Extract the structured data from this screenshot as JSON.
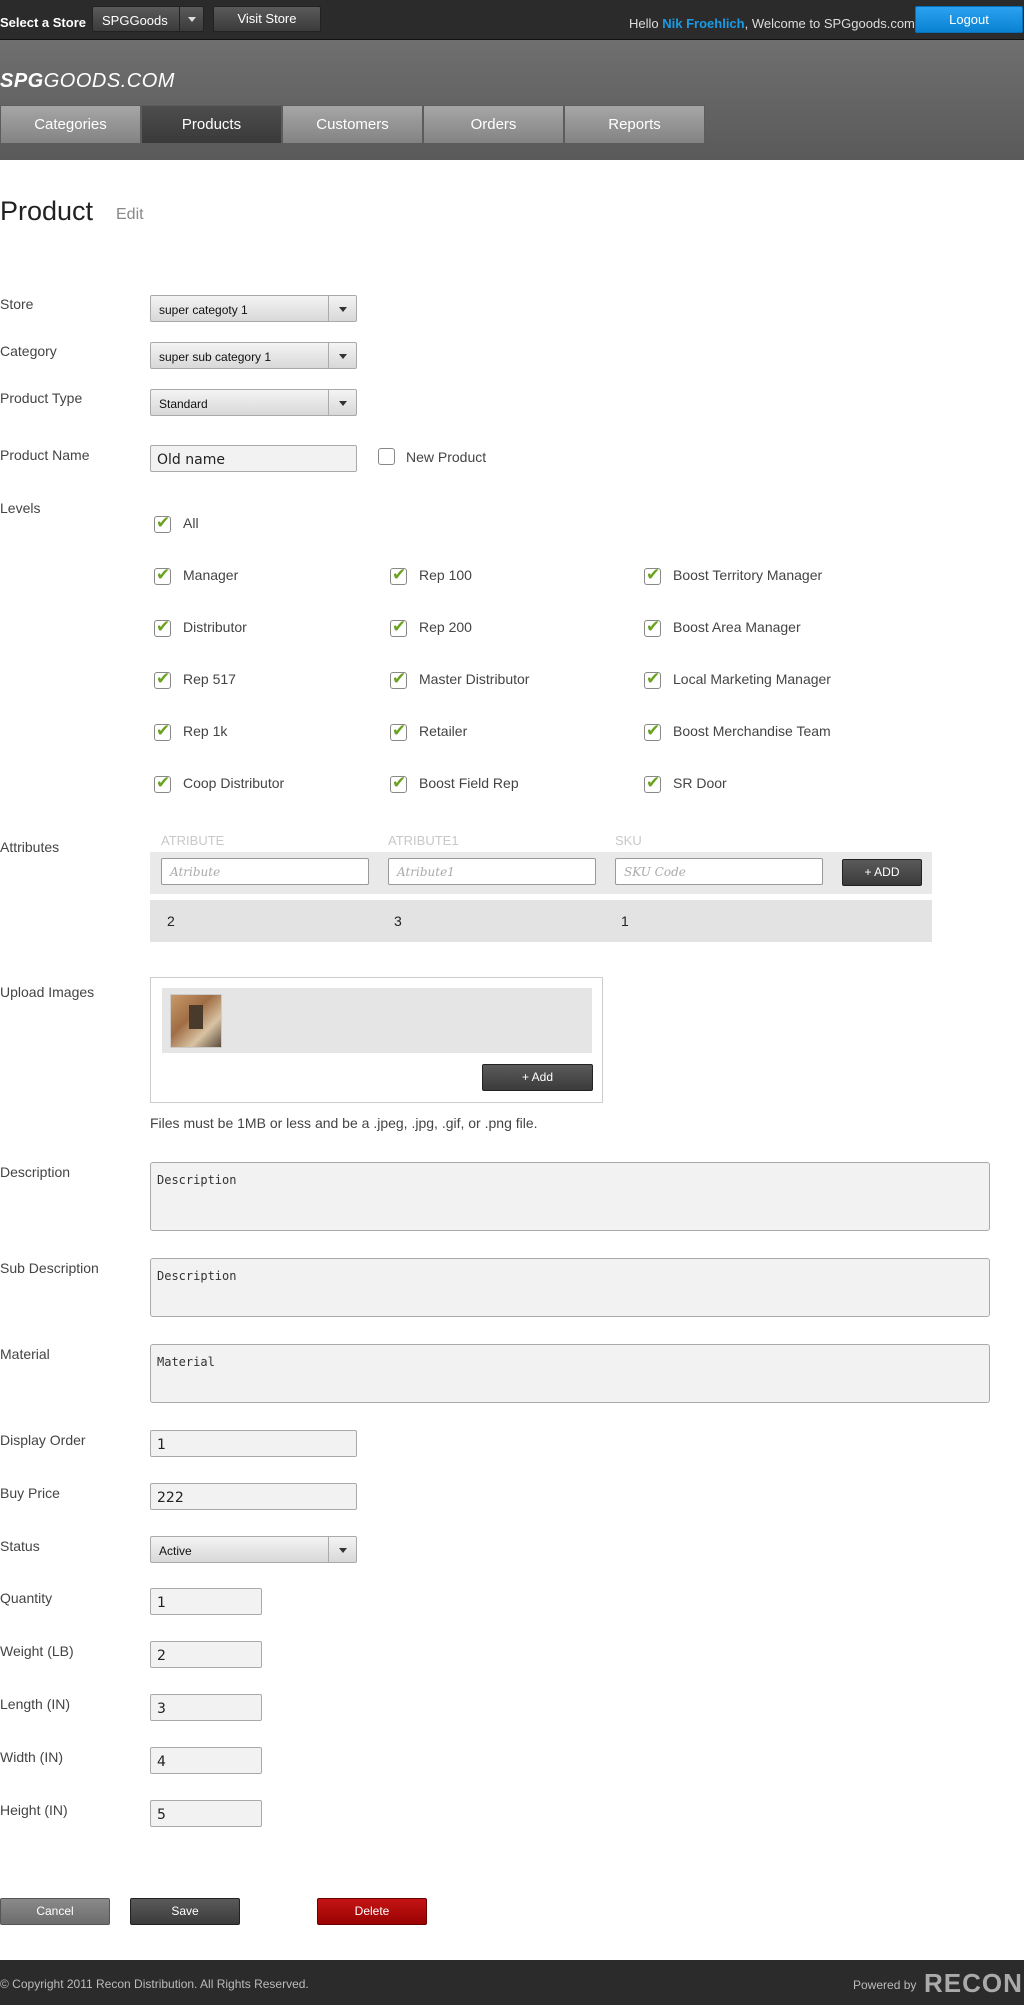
{
  "topbar": {
    "select_store_label": "Select a Store",
    "store_value": "SPGGoods",
    "visit_store_label": "Visit Store",
    "hello_prefix": "Hello",
    "user_name": "Nik Froehlich",
    "welcome_suffix": ", Welcome to SPGgoods.com",
    "logout_label": "Logout"
  },
  "header": {
    "logo_bold": "SPG",
    "logo_rest": "GOODS.COM",
    "nav": [
      "Categories",
      "Products",
      "Customers",
      "Orders",
      "Reports"
    ],
    "active_tab": "Products"
  },
  "page": {
    "title": "Product",
    "subtitle": "Edit"
  },
  "form": {
    "store": {
      "label": "Store",
      "value": "super categoty 1"
    },
    "category": {
      "label": "Category",
      "value": "super sub category 1"
    },
    "product_type": {
      "label": "Product Type",
      "value": "Standard"
    },
    "product_name": {
      "label": "Product Name",
      "value": "Old name",
      "new_product_label": "New Product",
      "new_product_checked": false
    },
    "levels": {
      "label": "Levels",
      "all_label": "All",
      "items": [
        [
          "Manager",
          "Rep 100",
          "Boost Territory Manager"
        ],
        [
          "Distributor",
          "Rep 200",
          "Boost Area Manager"
        ],
        [
          "Rep 517",
          "Master Distributor",
          "Local Marketing Manager"
        ],
        [
          "Rep 1k",
          "Retailer",
          "Boost Merchandise Team"
        ],
        [
          "Coop Distributor",
          "Boost Field Rep",
          "SR Door"
        ]
      ]
    },
    "attributes": {
      "label": "Attributes",
      "headers": [
        "ATRIBUTE",
        "ATRIBUTE1",
        "SKU"
      ],
      "placeholders": [
        "Atribute",
        "Atribute1",
        "SKU Code"
      ],
      "add_label": "+ ADD",
      "row": [
        "2",
        "3",
        "1"
      ]
    },
    "upload": {
      "label": "Upload Images",
      "add_label": "+ Add",
      "note": "Files must be 1MB or less and be a .jpeg, .jpg, .gif, or .png file."
    },
    "description": {
      "label": "Description",
      "value": "Description"
    },
    "sub_description": {
      "label": "Sub Description",
      "value": "Description"
    },
    "material": {
      "label": "Material",
      "value": "Material"
    },
    "display_order": {
      "label": "Display Order",
      "value": "1"
    },
    "buy_price": {
      "label": "Buy Price",
      "value": "222"
    },
    "status": {
      "label": "Status",
      "value": "Active"
    },
    "quantity": {
      "label": "Quantity",
      "value": "1"
    },
    "weight": {
      "label": "Weight (LB)",
      "value": "2"
    },
    "length": {
      "label": "Length (IN)",
      "value": "3"
    },
    "width": {
      "label": "Width (IN)",
      "value": "4"
    },
    "height": {
      "label": "Height (IN)",
      "value": "5"
    }
  },
  "actions": {
    "cancel": "Cancel",
    "save": "Save",
    "delete": "Delete"
  },
  "footer": {
    "copyright": "© Copyright 2011 Recon Distribution. All Rights Reserved.",
    "powered_by": "Powered by",
    "brand": "RECON"
  }
}
